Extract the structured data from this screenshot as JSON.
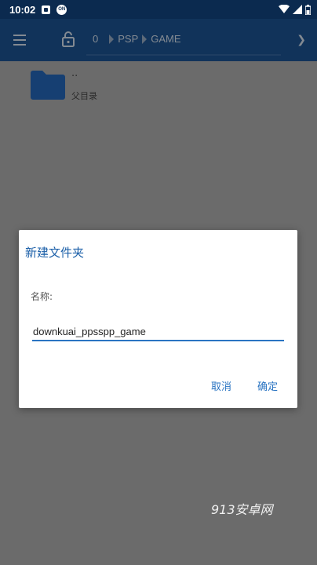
{
  "statusbar": {
    "time": "10:02",
    "notif_icon_2_label": "ON"
  },
  "toolbar": {
    "breadcrumbs": [
      "0",
      "PSP",
      "GAME"
    ]
  },
  "file_list": {
    "items": [
      {
        "name": "..",
        "subtitle": "父目录"
      }
    ]
  },
  "dialog": {
    "title": "新建文件夹",
    "name_label": "名称:",
    "name_value": "downkuai_ppsspp_game",
    "cancel_label": "取消",
    "ok_label": "确定"
  },
  "watermark": "913安卓网",
  "colors": {
    "appbar": "#1b4f8a",
    "accent": "#2a74c2",
    "dialog_title": "#1b5fa8",
    "folder": "#1d5aa0"
  }
}
